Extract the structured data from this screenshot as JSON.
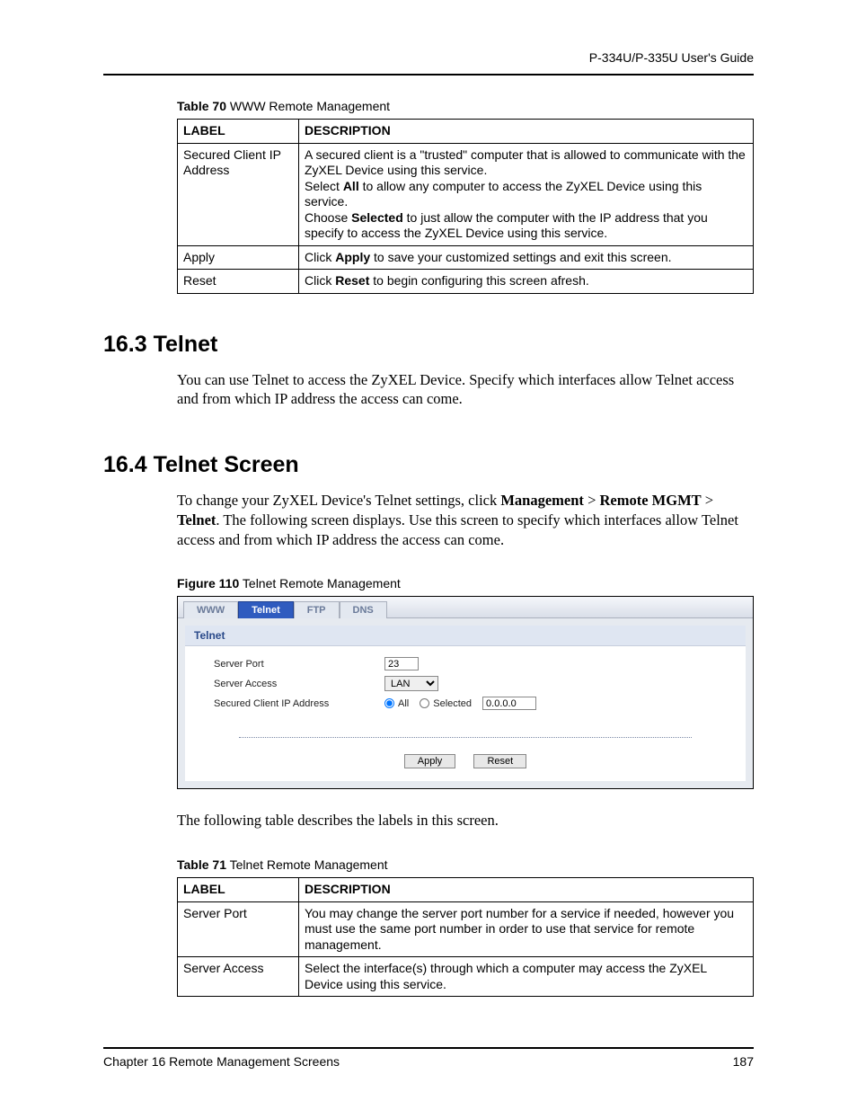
{
  "header": {
    "guide": "P-334U/P-335U User's Guide"
  },
  "table70": {
    "caption_bold": "Table 70",
    "caption_rest": "   WWW Remote Management",
    "header_label": "LABEL",
    "header_desc": "DESCRIPTION",
    "rows": [
      {
        "label": "Secured Client IP Address",
        "desc_parts": [
          {
            "t": "A secured client is a \"trusted\" computer that is allowed to communicate with the ZyXEL Device using this service."
          },
          {
            "pre": "Select ",
            "b": "All",
            "post": " to allow any computer to access the ZyXEL Device using this service."
          },
          {
            "pre": "Choose ",
            "b": "Selected",
            "post": " to just allow the computer with the IP address that you specify to access the ZyXEL Device using this service."
          }
        ]
      },
      {
        "label": "Apply",
        "desc_parts": [
          {
            "pre": "Click ",
            "b": "Apply",
            "post": " to save your customized settings and exit this screen."
          }
        ]
      },
      {
        "label": "Reset",
        "desc_parts": [
          {
            "pre": "Click ",
            "b": "Reset",
            "post": " to begin configuring this screen afresh."
          }
        ]
      }
    ]
  },
  "section163": {
    "heading": "16.3  Telnet",
    "body": "You can use Telnet to access the ZyXEL Device. Specify which interfaces allow Telnet access and from which IP address the access can come."
  },
  "section164": {
    "heading": "16.4  Telnet Screen",
    "body_pre": "To change your ZyXEL Device's Telnet settings, click ",
    "b1": "Management",
    "sep1": " > ",
    "b2": "Remote MGMT",
    "sep2": " > ",
    "b3": "Telnet",
    "body_post": ". The following screen displays. Use this screen to specify which interfaces allow Telnet access and from which IP address the access can come."
  },
  "figure110": {
    "caption_bold": "Figure 110",
    "caption_rest": "   Telnet Remote Management",
    "tabs": [
      "WWW",
      "Telnet",
      "FTP",
      "DNS"
    ],
    "panel_title": "Telnet",
    "labels": {
      "server_port": "Server Port",
      "server_access": "Server Access",
      "secured_ip": "Secured Client IP Address",
      "radio_all": "All",
      "radio_selected": "Selected"
    },
    "values": {
      "server_port": "23",
      "server_access": "LAN",
      "ip": "0.0.0.0"
    },
    "buttons": {
      "apply": "Apply",
      "reset": "Reset"
    }
  },
  "after_figure": "The following table describes the labels in this screen.",
  "table71": {
    "caption_bold": "Table 71",
    "caption_rest": "   Telnet Remote Management",
    "header_label": "LABEL",
    "header_desc": "DESCRIPTION",
    "rows": [
      {
        "label": "Server Port",
        "desc": "You may change the server port number for a service if needed, however you must use the same port number in order to use that service for remote management."
      },
      {
        "label": "Server Access",
        "desc": "Select the interface(s) through which a computer may access the ZyXEL Device using this service."
      }
    ]
  },
  "footer": {
    "chapter": "Chapter 16 Remote Management Screens",
    "page": "187"
  }
}
